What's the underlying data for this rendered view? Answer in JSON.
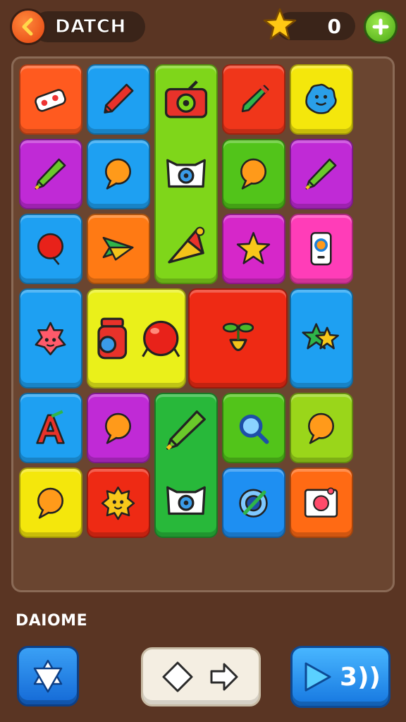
{
  "header": {
    "title": "DATCH",
    "score": "0",
    "back_icon": "chevron-left-icon",
    "star_icon": "star-icon",
    "add_icon": "plus-icon"
  },
  "board": {
    "tiles": [
      {
        "icon": "eraser-icon",
        "color": "#ff5a1f"
      },
      {
        "icon": "pencil-icon",
        "color": "#1ea0f2"
      },
      {
        "icon": "camera-icon",
        "color": "#7fd61a"
      },
      {
        "icon": "marker-icon",
        "color": "#f0361a"
      },
      {
        "icon": "blob-monster-icon",
        "color": "#f4e70c"
      },
      {
        "icon": "crayon-icon",
        "color": "#c02ad6"
      },
      {
        "icon": "speech-bubble-icon",
        "color": "#1ea0f2"
      },
      {
        "icon": "cat-camera-icon",
        "color": "#7fd61a"
      },
      {
        "icon": "speech-bubble-icon",
        "color": "#52c41a"
      },
      {
        "icon": "crayon-icon",
        "color": "#c02ad6"
      },
      {
        "icon": "balloon-icon",
        "color": "#1ea0f2"
      },
      {
        "icon": "paper-plane-icon",
        "color": "#ff7a14"
      },
      {
        "icon": "party-hat-icon",
        "color": "#7fd61a"
      },
      {
        "icon": "star-icon",
        "color": "#d627c9"
      },
      {
        "icon": "phone-icon",
        "color": "#ff3db8"
      },
      {
        "icon": "star-creature-icon",
        "color": "#1ea0f2"
      },
      {
        "icon": "jar-icon",
        "color": "#eaf01a"
      },
      {
        "icon": "ball-icon",
        "color": "#ee2a14"
      },
      {
        "icon": "plant-icon",
        "color": "#ee2a14"
      },
      {
        "icon": "double-star-icon",
        "color": "#1ea0f2"
      },
      {
        "icon": "letter-a-icon",
        "color": "#1ea0f2"
      },
      {
        "icon": "speech-bubble-icon",
        "color": "#c02ad6"
      },
      {
        "icon": "crayon-icon",
        "color": "#28b83a"
      },
      {
        "icon": "magnifier-icon",
        "color": "#52c41a"
      },
      {
        "icon": "speech-bubble-icon",
        "color": "#9ad61a"
      },
      {
        "icon": "speech-bubble-icon",
        "color": "#f4e70c"
      },
      {
        "icon": "sun-face-icon",
        "color": "#ee2a14"
      },
      {
        "icon": "cat-camera-icon",
        "color": "#28b83a"
      },
      {
        "icon": "target-icon",
        "color": "#1e8ff2"
      },
      {
        "icon": "picture-frame-icon",
        "color": "#ff6a14"
      }
    ]
  },
  "footer": {
    "label": "DAIOME",
    "left_button_icon": "star-of-david-icon",
    "middle_left_icon": "diamond-arrow-icon",
    "middle_right_icon": "arrow-right-icon",
    "right_button_icon": "play-icon",
    "right_button_text": "3))"
  }
}
